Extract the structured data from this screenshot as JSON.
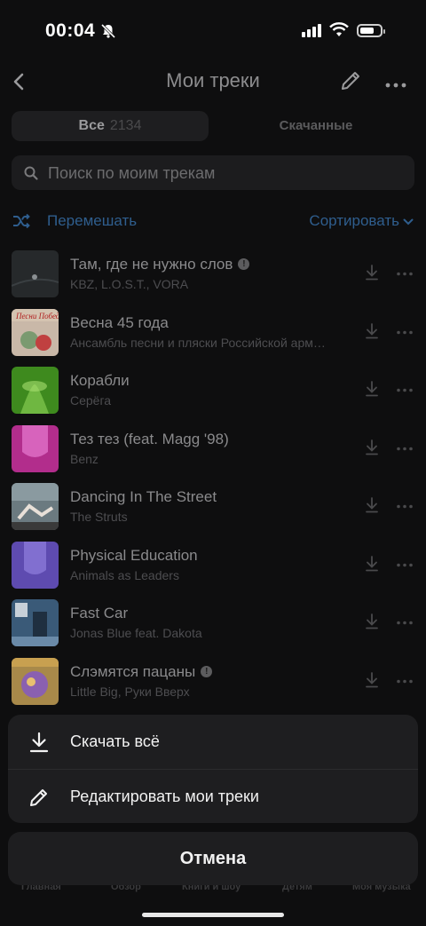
{
  "status_bar": {
    "time": "00:04"
  },
  "header": {
    "title": "Мои треки"
  },
  "tabs": {
    "all_label": "Все",
    "all_count": "2134",
    "downloaded_label": "Скачанные"
  },
  "search": {
    "placeholder": "Поиск по моим трекам"
  },
  "controls": {
    "shuffle_label": "Перемешать",
    "sort_label": "Сортировать"
  },
  "tracks": [
    {
      "title": "Там, где не нужно слов",
      "artist": "KBZ, L.O.S.T., VORA",
      "explicit": true,
      "cover": "#26292b"
    },
    {
      "title": "Весна 45 года",
      "artist": "Ансамбль песни и пляски Российской арм…",
      "explicit": false,
      "cover": "#c9b8a8"
    },
    {
      "title": "Корабли",
      "artist": "Серёга",
      "explicit": false,
      "cover": "#3e8a1e"
    },
    {
      "title": "Тез тез (feat. Magg '98)",
      "artist": "Benz",
      "explicit": false,
      "cover": "#b22d8c"
    },
    {
      "title": "Dancing In The Street",
      "artist": "The Struts",
      "explicit": false,
      "cover": "#6b7a80"
    },
    {
      "title": "Physical Education",
      "artist": "Animals as Leaders",
      "explicit": false,
      "cover": "#5e4bb0"
    },
    {
      "title": "Fast Car",
      "artist": "Jonas Blue feat. Dakota",
      "explicit": false,
      "cover": "#3a5a78"
    },
    {
      "title": "Слэмятся пацаны",
      "artist": "Little Big, Руки Вверх",
      "explicit": true,
      "cover": "#a8894a"
    }
  ],
  "action_sheet": {
    "download_all": "Скачать всё",
    "edit_tracks": "Редактировать мои треки",
    "cancel": "Отмена"
  },
  "bottom_nav": [
    "Главная",
    "Обзор",
    "Книги и шоу",
    "Детям",
    "Моя музыка"
  ]
}
